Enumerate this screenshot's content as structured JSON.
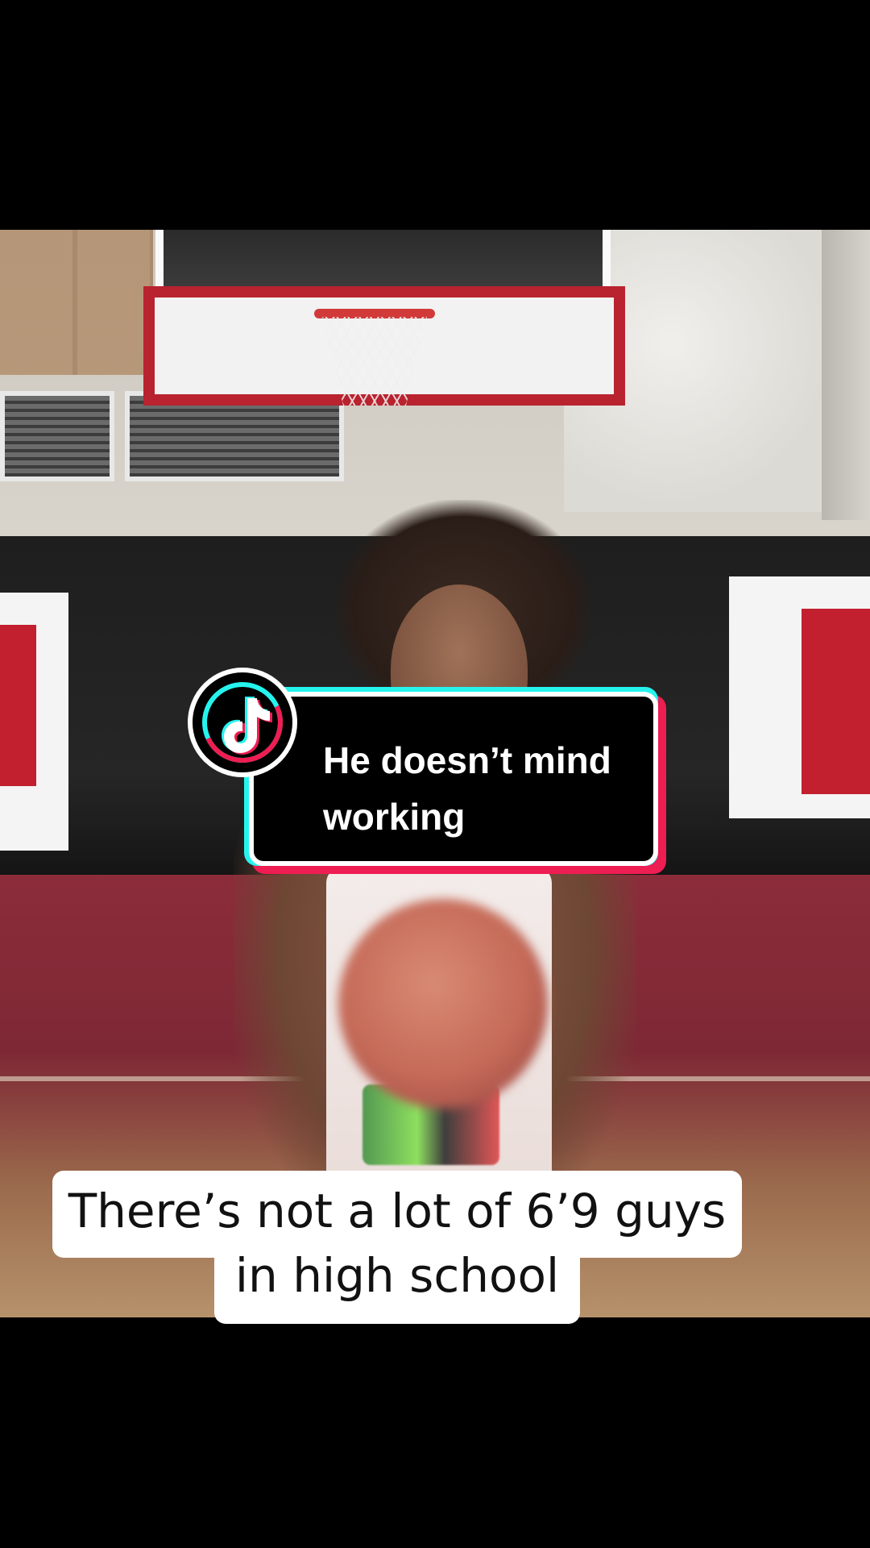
{
  "sticker": {
    "logo_icon": "tiktok-logo-icon",
    "line1": "He doesn’t mind",
    "line2": "working",
    "colors": {
      "cyan": "#25f4ee",
      "red": "#ee1d52"
    }
  },
  "caption": {
    "line1": "There’s not a lot of 6’9 guys",
    "line2": "in high school"
  }
}
